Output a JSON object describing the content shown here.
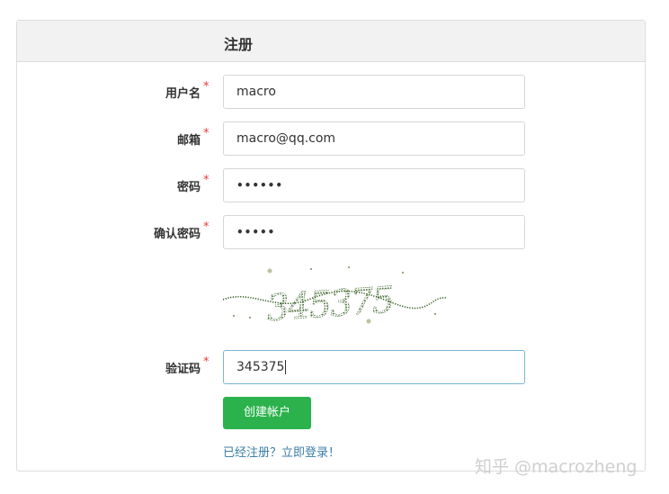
{
  "panel": {
    "title": "注册"
  },
  "form": {
    "required_mark": "*",
    "username": {
      "label": "用户名",
      "value": "macro"
    },
    "email": {
      "label": "邮箱",
      "value": "macro@qq.com"
    },
    "password": {
      "label": "密码",
      "value": "••••••"
    },
    "confirm_password": {
      "label": "确认密码",
      "value": "•••••"
    },
    "captcha_image": {
      "text": "345375"
    },
    "captcha": {
      "label": "验证码",
      "value": "345375"
    },
    "submit_label": "创建帐户",
    "login_link": "已经注册？立即登录！"
  },
  "watermark": "知乎 @macrozheng",
  "colors": {
    "primary_button": "#2bb24c",
    "link": "#3b7ea8",
    "required": "#e23c3c",
    "focus_border": "#76b6d6"
  }
}
